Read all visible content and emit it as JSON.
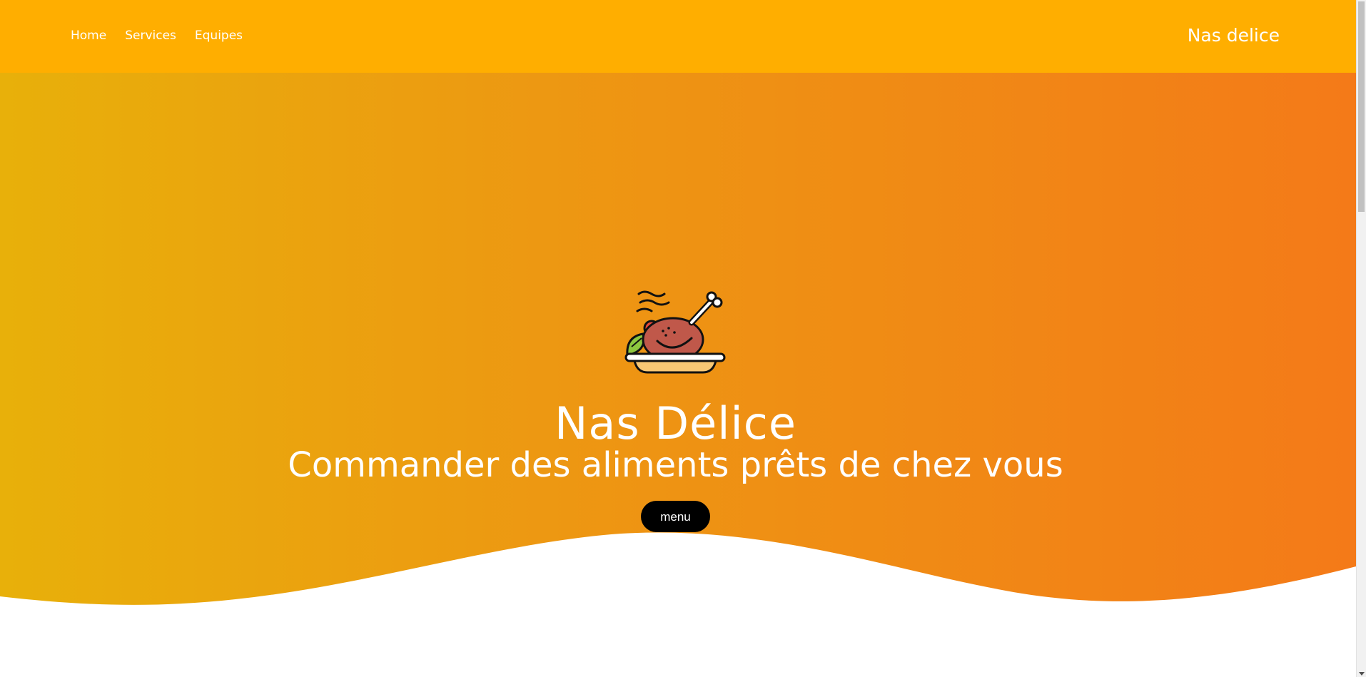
{
  "nav": {
    "links": [
      {
        "label": "Home"
      },
      {
        "label": "Services"
      },
      {
        "label": "Equipes"
      }
    ],
    "brand": "Nas delice"
  },
  "hero": {
    "icon": "roast-chicken-plate-icon",
    "title": "Nas Délice",
    "subtitle": "Commander des aliments prêts de chez vous",
    "button_label": "menu"
  },
  "colors": {
    "navbar": "#ffae00",
    "gradient_start": "#e8b00a",
    "gradient_end": "#f47a18",
    "button": "#000000",
    "text": "#ffffff"
  }
}
